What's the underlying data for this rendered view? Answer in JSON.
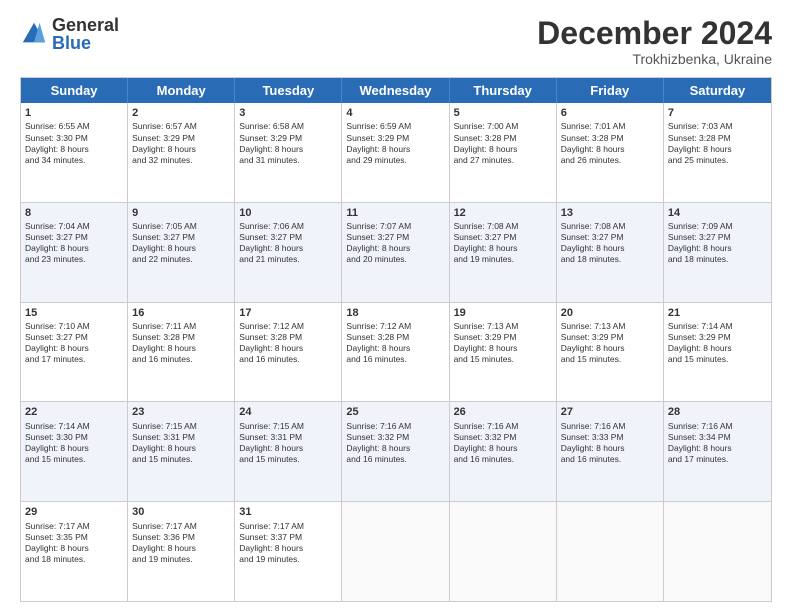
{
  "logo": {
    "general": "General",
    "blue": "Blue"
  },
  "title": "December 2024",
  "subtitle": "Trokhizbenka, Ukraine",
  "header_days": [
    "Sunday",
    "Monday",
    "Tuesday",
    "Wednesday",
    "Thursday",
    "Friday",
    "Saturday"
  ],
  "rows": [
    [
      {
        "day": "1",
        "lines": [
          "Sunrise: 6:55 AM",
          "Sunset: 3:30 PM",
          "Daylight: 8 hours",
          "and 34 minutes."
        ]
      },
      {
        "day": "2",
        "lines": [
          "Sunrise: 6:57 AM",
          "Sunset: 3:29 PM",
          "Daylight: 8 hours",
          "and 32 minutes."
        ]
      },
      {
        "day": "3",
        "lines": [
          "Sunrise: 6:58 AM",
          "Sunset: 3:29 PM",
          "Daylight: 8 hours",
          "and 31 minutes."
        ]
      },
      {
        "day": "4",
        "lines": [
          "Sunrise: 6:59 AM",
          "Sunset: 3:29 PM",
          "Daylight: 8 hours",
          "and 29 minutes."
        ]
      },
      {
        "day": "5",
        "lines": [
          "Sunrise: 7:00 AM",
          "Sunset: 3:28 PM",
          "Daylight: 8 hours",
          "and 27 minutes."
        ]
      },
      {
        "day": "6",
        "lines": [
          "Sunrise: 7:01 AM",
          "Sunset: 3:28 PM",
          "Daylight: 8 hours",
          "and 26 minutes."
        ]
      },
      {
        "day": "7",
        "lines": [
          "Sunrise: 7:03 AM",
          "Sunset: 3:28 PM",
          "Daylight: 8 hours",
          "and 25 minutes."
        ]
      }
    ],
    [
      {
        "day": "8",
        "lines": [
          "Sunrise: 7:04 AM",
          "Sunset: 3:27 PM",
          "Daylight: 8 hours",
          "and 23 minutes."
        ]
      },
      {
        "day": "9",
        "lines": [
          "Sunrise: 7:05 AM",
          "Sunset: 3:27 PM",
          "Daylight: 8 hours",
          "and 22 minutes."
        ]
      },
      {
        "day": "10",
        "lines": [
          "Sunrise: 7:06 AM",
          "Sunset: 3:27 PM",
          "Daylight: 8 hours",
          "and 21 minutes."
        ]
      },
      {
        "day": "11",
        "lines": [
          "Sunrise: 7:07 AM",
          "Sunset: 3:27 PM",
          "Daylight: 8 hours",
          "and 20 minutes."
        ]
      },
      {
        "day": "12",
        "lines": [
          "Sunrise: 7:08 AM",
          "Sunset: 3:27 PM",
          "Daylight: 8 hours",
          "and 19 minutes."
        ]
      },
      {
        "day": "13",
        "lines": [
          "Sunrise: 7:08 AM",
          "Sunset: 3:27 PM",
          "Daylight: 8 hours",
          "and 18 minutes."
        ]
      },
      {
        "day": "14",
        "lines": [
          "Sunrise: 7:09 AM",
          "Sunset: 3:27 PM",
          "Daylight: 8 hours",
          "and 18 minutes."
        ]
      }
    ],
    [
      {
        "day": "15",
        "lines": [
          "Sunrise: 7:10 AM",
          "Sunset: 3:27 PM",
          "Daylight: 8 hours",
          "and 17 minutes."
        ]
      },
      {
        "day": "16",
        "lines": [
          "Sunrise: 7:11 AM",
          "Sunset: 3:28 PM",
          "Daylight: 8 hours",
          "and 16 minutes."
        ]
      },
      {
        "day": "17",
        "lines": [
          "Sunrise: 7:12 AM",
          "Sunset: 3:28 PM",
          "Daylight: 8 hours",
          "and 16 minutes."
        ]
      },
      {
        "day": "18",
        "lines": [
          "Sunrise: 7:12 AM",
          "Sunset: 3:28 PM",
          "Daylight: 8 hours",
          "and 16 minutes."
        ]
      },
      {
        "day": "19",
        "lines": [
          "Sunrise: 7:13 AM",
          "Sunset: 3:29 PM",
          "Daylight: 8 hours",
          "and 15 minutes."
        ]
      },
      {
        "day": "20",
        "lines": [
          "Sunrise: 7:13 AM",
          "Sunset: 3:29 PM",
          "Daylight: 8 hours",
          "and 15 minutes."
        ]
      },
      {
        "day": "21",
        "lines": [
          "Sunrise: 7:14 AM",
          "Sunset: 3:29 PM",
          "Daylight: 8 hours",
          "and 15 minutes."
        ]
      }
    ],
    [
      {
        "day": "22",
        "lines": [
          "Sunrise: 7:14 AM",
          "Sunset: 3:30 PM",
          "Daylight: 8 hours",
          "and 15 minutes."
        ]
      },
      {
        "day": "23",
        "lines": [
          "Sunrise: 7:15 AM",
          "Sunset: 3:31 PM",
          "Daylight: 8 hours",
          "and 15 minutes."
        ]
      },
      {
        "day": "24",
        "lines": [
          "Sunrise: 7:15 AM",
          "Sunset: 3:31 PM",
          "Daylight: 8 hours",
          "and 15 minutes."
        ]
      },
      {
        "day": "25",
        "lines": [
          "Sunrise: 7:16 AM",
          "Sunset: 3:32 PM",
          "Daylight: 8 hours",
          "and 16 minutes."
        ]
      },
      {
        "day": "26",
        "lines": [
          "Sunrise: 7:16 AM",
          "Sunset: 3:32 PM",
          "Daylight: 8 hours",
          "and 16 minutes."
        ]
      },
      {
        "day": "27",
        "lines": [
          "Sunrise: 7:16 AM",
          "Sunset: 3:33 PM",
          "Daylight: 8 hours",
          "and 16 minutes."
        ]
      },
      {
        "day": "28",
        "lines": [
          "Sunrise: 7:16 AM",
          "Sunset: 3:34 PM",
          "Daylight: 8 hours",
          "and 17 minutes."
        ]
      }
    ],
    [
      {
        "day": "29",
        "lines": [
          "Sunrise: 7:17 AM",
          "Sunset: 3:35 PM",
          "Daylight: 8 hours",
          "and 18 minutes."
        ]
      },
      {
        "day": "30",
        "lines": [
          "Sunrise: 7:17 AM",
          "Sunset: 3:36 PM",
          "Daylight: 8 hours",
          "and 19 minutes."
        ]
      },
      {
        "day": "31",
        "lines": [
          "Sunrise: 7:17 AM",
          "Sunset: 3:37 PM",
          "Daylight: 8 hours",
          "and 19 minutes."
        ]
      },
      null,
      null,
      null,
      null
    ]
  ]
}
